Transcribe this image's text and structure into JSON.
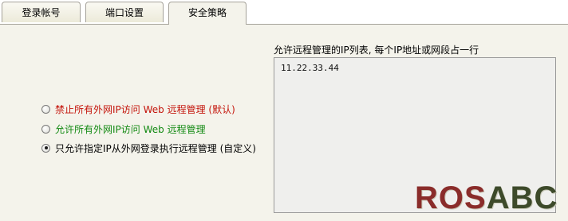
{
  "tabs": [
    {
      "label": "登录帐号",
      "active": false
    },
    {
      "label": "端口设置",
      "active": false
    },
    {
      "label": "安全策略",
      "active": true
    }
  ],
  "policy": {
    "options": [
      {
        "label": "禁止所有外网IP访问 Web 远程管理 (默认)",
        "checked": false,
        "color": "#c4140b"
      },
      {
        "label": "允许所有外网IP访问 Web 远程管理",
        "checked": false,
        "color": "#138a13"
      },
      {
        "label": "只允许指定IP从外网登录执行远程管理 (自定义)",
        "checked": true,
        "color": "#000000"
      }
    ]
  },
  "iplist": {
    "caption": "允许远程管理的IP列表, 每个IP地址或网段占一行",
    "value": "11.22.33.44"
  },
  "watermark": {
    "prefix": "ROS",
    "suffix": "ABC"
  }
}
